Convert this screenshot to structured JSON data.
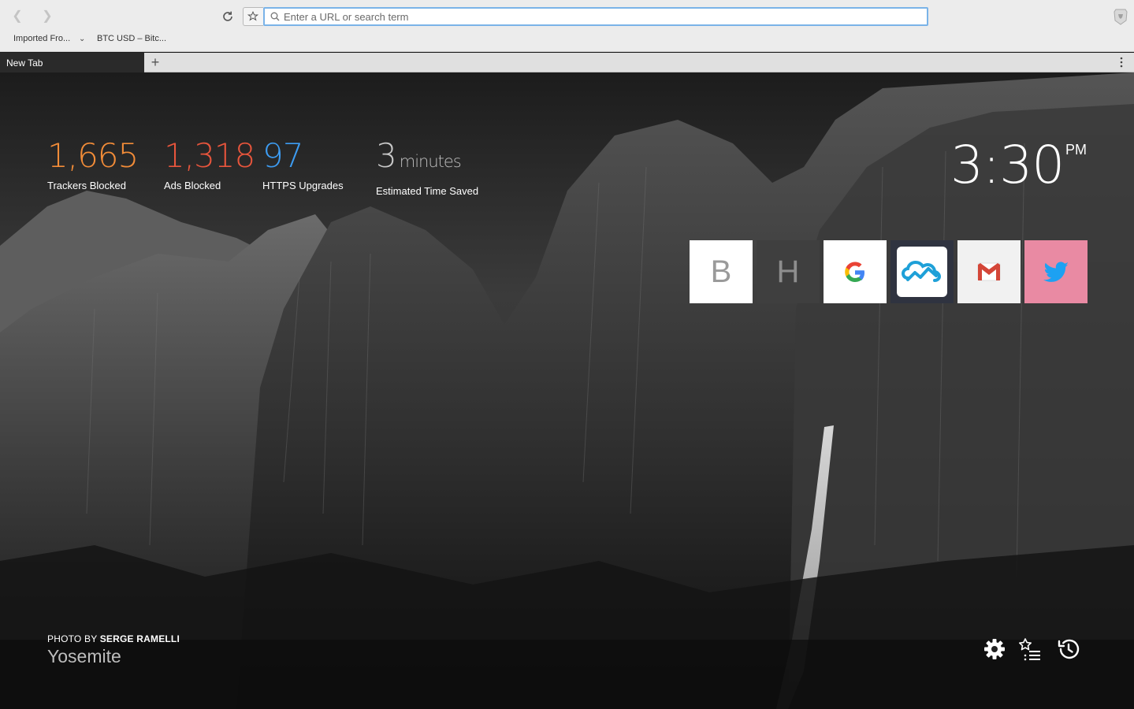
{
  "browser": {
    "url_placeholder": "Enter a URL or search term",
    "bookmarks": [
      "Imported Fro...",
      "BTC USD – Bitc..."
    ],
    "tab_title": "New Tab",
    "accent_color": "#7ab3e8"
  },
  "stats": [
    {
      "value": "1,665",
      "label": "Trackers Blocked",
      "color": "#f28c38"
    },
    {
      "value": "1,318",
      "label": "Ads Blocked",
      "color": "#e8553c"
    },
    {
      "value": "97",
      "label": "HTTPS Upgrades",
      "color": "#3d9cf2"
    },
    {
      "value": "3",
      "unit": "minutes",
      "label": "Estimated Time Saved",
      "color": "#c9c9c9"
    }
  ],
  "clock": {
    "time": "3:30",
    "ampm": "PM"
  },
  "top_sites": [
    {
      "letter": "B",
      "icon": "letter-b-icon"
    },
    {
      "letter": "H",
      "icon": "letter-h-icon"
    },
    {
      "icon": "google-icon"
    },
    {
      "icon": "cloud-chart-icon"
    },
    {
      "icon": "gmail-icon"
    },
    {
      "icon": "twitter-icon"
    }
  ],
  "photo": {
    "prefix": "PHOTO BY ",
    "author": "SERGE RAMELLI",
    "place": "Yosemite"
  },
  "actions": [
    "settings-icon",
    "bookmarks-icon",
    "history-icon"
  ]
}
